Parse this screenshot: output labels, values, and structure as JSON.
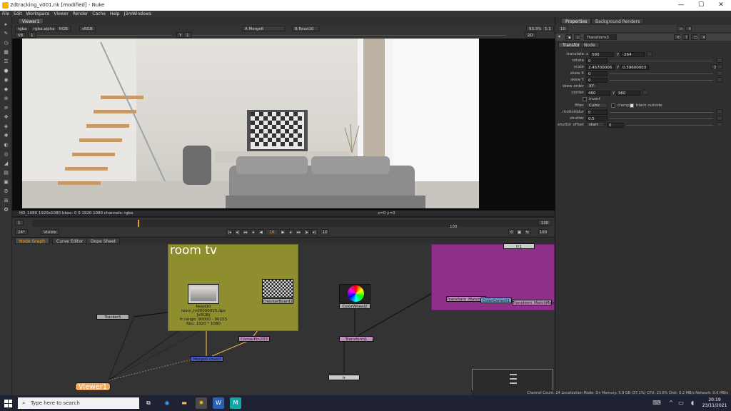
{
  "window": {
    "title": "2dtracking_v001.nk [modified] - Nuke",
    "minimize": "—",
    "maximize": "☐",
    "close": "✕"
  },
  "menu": [
    "File",
    "Edit",
    "Workspace",
    "Viewer",
    "Render",
    "Cache",
    "Help",
    "J3mWindows"
  ],
  "viewer": {
    "tab": "Viewer1",
    "channels": "rgba",
    "layer": "rgba.alpha",
    "colorspace_a": "RGB",
    "colorspace_b": "sRGB",
    "a_input": "A  Merge6",
    "b_input": "B  Read10",
    "zoom": "93.3%",
    "ratio": "1:1",
    "mode": "2D",
    "frame_f": "f/8",
    "gain": "1",
    "y": "Y",
    "gamma": "1",
    "status_left": "HD_1080 1920x1080  bbox: 0 0 1920 1080 channels: rgba",
    "status_mid": "x=0 y=0"
  },
  "timeline": {
    "fps": "24*",
    "range_mode": "Visible",
    "current_frame": "16",
    "start": "1",
    "end": "100",
    "end2": "100",
    "increment": "10"
  },
  "nodegraph": {
    "tabs": [
      "Node Graph",
      "Curve Editor",
      "Dope Sheet"
    ],
    "backdrop_title": "room tv",
    "nodes": {
      "read": "Read10",
      "read_info": [
        "room_tv00090015.dpx",
        "[sRGB]",
        "fr range: 90000 - 90253",
        "Res: 1920 * 1080"
      ],
      "checker": "CheckerBoard2",
      "tracker": "Tracker5",
      "cornerpin": "CornerPin2D3",
      "merge": "Merge6 (over)",
      "viewer": "Viewer1",
      "colorwheel": "ColorWheel2",
      "transform": "Transform1",
      "tr_bottom": "tr",
      "tr_top": "tr1",
      "match1": "Transform_MatchMove1",
      "cc": "ColorCorrect1",
      "match2": "Transform_MatchMove1"
    }
  },
  "properties": {
    "tabs": [
      "Properties",
      "Background Renders"
    ],
    "count": "10",
    "node_name": "Transform3",
    "sub_tabs": [
      "Transform",
      "Node"
    ],
    "translate_x": "560",
    "translate_y": "-264",
    "rotate": "0",
    "scale_x": "2.45700006",
    "scale_y": "0.59600003",
    "scale_link": "2",
    "skew_x": "0",
    "skew_y": "0",
    "skew_order": "XY",
    "center_x": "460",
    "center_y": "960",
    "invert": "invert",
    "filter": "Cubic",
    "clamp": "clamp",
    "black_outside": "black outside",
    "motionblur": "0",
    "shutter": "0.5",
    "shutter_offset": "start",
    "shutter_offset_val": "0",
    "labels": {
      "translate": "translate",
      "x": "x",
      "y": "y",
      "rotate": "rotate",
      "scale": "scale",
      "skewx": "skew X",
      "skewy": "skew Y",
      "skeworder": "skew order",
      "center": "center",
      "filter": "filter",
      "motionblur": "motionblur",
      "shutter": "shutter",
      "shutteroffset": "shutter offset"
    }
  },
  "statusline": "Channel Count: 24  Localization Mode: On  Memory: 5.9 GB (37.1%)  CPU: 23.8%  Disk: 0.2 MB/s  Network: 0.0 MB/s",
  "taskbar": {
    "search": "Type here to search",
    "time": "20:19",
    "date": "23/11/2021"
  }
}
